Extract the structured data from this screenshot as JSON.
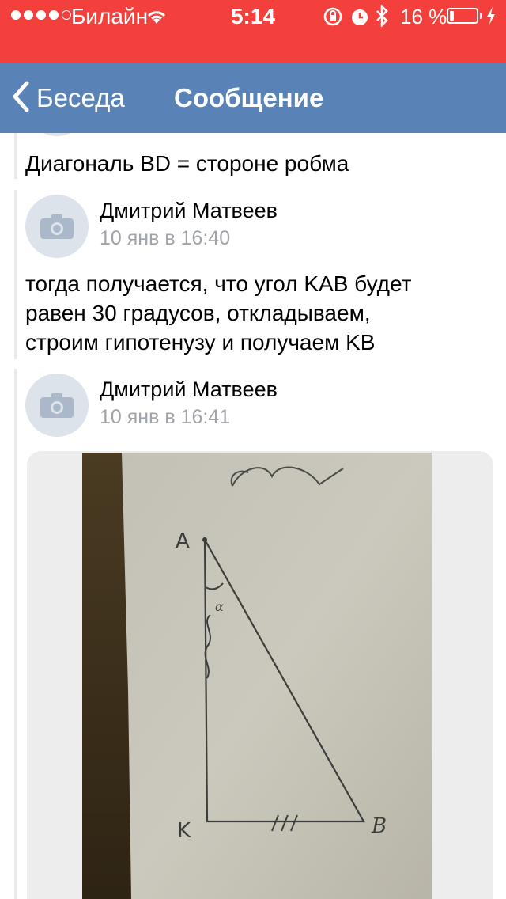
{
  "status_bar": {
    "carrier": "Билайн",
    "time": "5:14",
    "battery_percent": "16 %",
    "battery_level": 0.16,
    "signal_bars": 4,
    "icons": [
      "signal-dots-icon",
      "wifi-icon",
      "rotation-lock-icon",
      "alarm-icon",
      "bluetooth-icon",
      "battery-icon",
      "charging-bolt-icon"
    ]
  },
  "nav": {
    "back_label": "Беседа",
    "title": "Сообщение",
    "icons": [
      "chevron-left-icon"
    ]
  },
  "messages": [
    {
      "text": "Диагональ BD = стороне робма"
    },
    {
      "author": "Дмитрий Матвеев",
      "timestamp": "10 янв в 16:40",
      "text_lines": [
        "тогда получается, что угол KAB будет",
        "равен 30 градусов, откладываем,",
        "строим гипотенузу и получаем KB"
      ],
      "avatar_icon": "camera-icon"
    },
    {
      "author": "Дмитрий Матвеев",
      "timestamp": "10 янв в 16:41",
      "attachment": "photo",
      "avatar_icon": "camera-icon",
      "photo_labels": [
        "A",
        "K",
        "B"
      ]
    }
  ],
  "colors": {
    "status_bar": "#f4403c",
    "nav_bar": "#5982b6",
    "timestamp": "#a0a4a8",
    "thread_line": "#e9eaed"
  }
}
